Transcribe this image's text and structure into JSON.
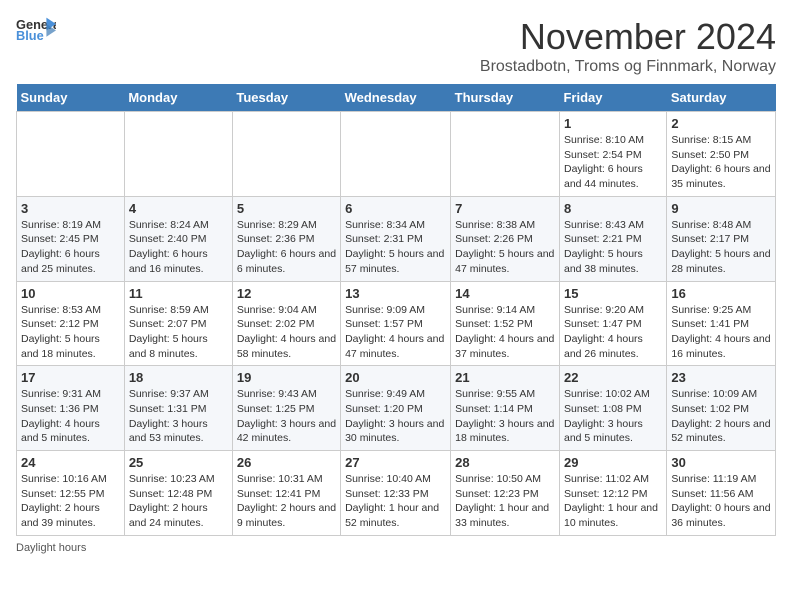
{
  "header": {
    "logo_general": "General",
    "logo_blue": "Blue",
    "title": "November 2024",
    "location": "Brostadbotn, Troms og Finnmark, Norway"
  },
  "calendar": {
    "weekdays": [
      "Sunday",
      "Monday",
      "Tuesday",
      "Wednesday",
      "Thursday",
      "Friday",
      "Saturday"
    ],
    "weeks": [
      [
        {
          "day": "",
          "info": ""
        },
        {
          "day": "",
          "info": ""
        },
        {
          "day": "",
          "info": ""
        },
        {
          "day": "",
          "info": ""
        },
        {
          "day": "",
          "info": ""
        },
        {
          "day": "1",
          "info": "Sunrise: 8:10 AM\nSunset: 2:54 PM\nDaylight: 6 hours and 44 minutes."
        },
        {
          "day": "2",
          "info": "Sunrise: 8:15 AM\nSunset: 2:50 PM\nDaylight: 6 hours and 35 minutes."
        }
      ],
      [
        {
          "day": "3",
          "info": "Sunrise: 8:19 AM\nSunset: 2:45 PM\nDaylight: 6 hours and 25 minutes."
        },
        {
          "day": "4",
          "info": "Sunrise: 8:24 AM\nSunset: 2:40 PM\nDaylight: 6 hours and 16 minutes."
        },
        {
          "day": "5",
          "info": "Sunrise: 8:29 AM\nSunset: 2:36 PM\nDaylight: 6 hours and 6 minutes."
        },
        {
          "day": "6",
          "info": "Sunrise: 8:34 AM\nSunset: 2:31 PM\nDaylight: 5 hours and 57 minutes."
        },
        {
          "day": "7",
          "info": "Sunrise: 8:38 AM\nSunset: 2:26 PM\nDaylight: 5 hours and 47 minutes."
        },
        {
          "day": "8",
          "info": "Sunrise: 8:43 AM\nSunset: 2:21 PM\nDaylight: 5 hours and 38 minutes."
        },
        {
          "day": "9",
          "info": "Sunrise: 8:48 AM\nSunset: 2:17 PM\nDaylight: 5 hours and 28 minutes."
        }
      ],
      [
        {
          "day": "10",
          "info": "Sunrise: 8:53 AM\nSunset: 2:12 PM\nDaylight: 5 hours and 18 minutes."
        },
        {
          "day": "11",
          "info": "Sunrise: 8:59 AM\nSunset: 2:07 PM\nDaylight: 5 hours and 8 minutes."
        },
        {
          "day": "12",
          "info": "Sunrise: 9:04 AM\nSunset: 2:02 PM\nDaylight: 4 hours and 58 minutes."
        },
        {
          "day": "13",
          "info": "Sunrise: 9:09 AM\nSunset: 1:57 PM\nDaylight: 4 hours and 47 minutes."
        },
        {
          "day": "14",
          "info": "Sunrise: 9:14 AM\nSunset: 1:52 PM\nDaylight: 4 hours and 37 minutes."
        },
        {
          "day": "15",
          "info": "Sunrise: 9:20 AM\nSunset: 1:47 PM\nDaylight: 4 hours and 26 minutes."
        },
        {
          "day": "16",
          "info": "Sunrise: 9:25 AM\nSunset: 1:41 PM\nDaylight: 4 hours and 16 minutes."
        }
      ],
      [
        {
          "day": "17",
          "info": "Sunrise: 9:31 AM\nSunset: 1:36 PM\nDaylight: 4 hours and 5 minutes."
        },
        {
          "day": "18",
          "info": "Sunrise: 9:37 AM\nSunset: 1:31 PM\nDaylight: 3 hours and 53 minutes."
        },
        {
          "day": "19",
          "info": "Sunrise: 9:43 AM\nSunset: 1:25 PM\nDaylight: 3 hours and 42 minutes."
        },
        {
          "day": "20",
          "info": "Sunrise: 9:49 AM\nSunset: 1:20 PM\nDaylight: 3 hours and 30 minutes."
        },
        {
          "day": "21",
          "info": "Sunrise: 9:55 AM\nSunset: 1:14 PM\nDaylight: 3 hours and 18 minutes."
        },
        {
          "day": "22",
          "info": "Sunrise: 10:02 AM\nSunset: 1:08 PM\nDaylight: 3 hours and 5 minutes."
        },
        {
          "day": "23",
          "info": "Sunrise: 10:09 AM\nSunset: 1:02 PM\nDaylight: 2 hours and 52 minutes."
        }
      ],
      [
        {
          "day": "24",
          "info": "Sunrise: 10:16 AM\nSunset: 12:55 PM\nDaylight: 2 hours and 39 minutes."
        },
        {
          "day": "25",
          "info": "Sunrise: 10:23 AM\nSunset: 12:48 PM\nDaylight: 2 hours and 24 minutes."
        },
        {
          "day": "26",
          "info": "Sunrise: 10:31 AM\nSunset: 12:41 PM\nDaylight: 2 hours and 9 minutes."
        },
        {
          "day": "27",
          "info": "Sunrise: 10:40 AM\nSunset: 12:33 PM\nDaylight: 1 hour and 52 minutes."
        },
        {
          "day": "28",
          "info": "Sunrise: 10:50 AM\nSunset: 12:23 PM\nDaylight: 1 hour and 33 minutes."
        },
        {
          "day": "29",
          "info": "Sunrise: 11:02 AM\nSunset: 12:12 PM\nDaylight: 1 hour and 10 minutes."
        },
        {
          "day": "30",
          "info": "Sunrise: 11:19 AM\nSunset: 11:56 AM\nDaylight: 0 hours and 36 minutes."
        }
      ]
    ]
  },
  "footer": {
    "note": "Daylight hours"
  }
}
